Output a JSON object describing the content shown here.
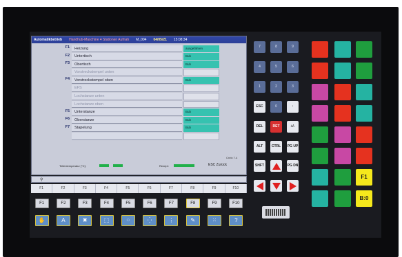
{
  "titlebar": {
    "mode": "Automatikbetrieb",
    "subtitle": "Handhub-Maschine 4 Stationen Aufnah",
    "program": "M_004",
    "date": "04/05/21",
    "time": "15:08:34"
  },
  "rows": [
    {
      "key": "F1",
      "label": "Heizung",
      "status": "ausgefahren",
      "state": "on",
      "disabled": false
    },
    {
      "key": "F2",
      "label": "Untertisch",
      "status": "Bub",
      "state": "on",
      "disabled": false
    },
    {
      "key": "F3",
      "label": "Obertisch",
      "status": "Bub",
      "state": "on",
      "disabled": false
    },
    {
      "key": "",
      "label": "Vorstreckstempel unten",
      "status": "",
      "state": "off",
      "disabled": true
    },
    {
      "key": "F4",
      "label": "Vorstreckstempel oben",
      "status": "Bub",
      "state": "on",
      "disabled": false
    },
    {
      "key": "",
      "label": "EFS",
      "status": "",
      "state": "off",
      "disabled": true
    },
    {
      "key": "",
      "label": "Lochstanze unten",
      "status": "",
      "state": "off",
      "disabled": true
    },
    {
      "key": "",
      "label": "Lochstanze oben",
      "status": "",
      "state": "off",
      "disabled": true
    },
    {
      "key": "F5",
      "label": "Unterstanze",
      "status": "Bub",
      "state": "on",
      "disabled": false
    },
    {
      "key": "F6",
      "label": "Oberstanze",
      "status": "Bub",
      "state": "on",
      "disabled": false
    },
    {
      "key": "F7",
      "label": "Stapelung",
      "status": "Bub",
      "state": "on",
      "disabled": false
    },
    {
      "key": "",
      "label": "",
      "status": "",
      "state": "off",
      "disabled": true
    }
  ],
  "status_line": {
    "temp_label": "Tellentemperatur [°C]:",
    "recipe_label": "Rezept:",
    "esc_label": "ESC Zurück",
    "cycle_label": "Crein 7.4"
  },
  "fstrip": [
    "F1",
    "F2",
    "F3",
    "F4",
    "F5",
    "F6",
    "F7",
    "F8",
    "F9",
    "F10"
  ],
  "fkeys": [
    "F1",
    "F2",
    "F3",
    "F4",
    "F5",
    "F6",
    "F7",
    "F8",
    "F9",
    "F10"
  ],
  "icon_keys": [
    {
      "icon": "hand-icon",
      "glyph": "✋"
    },
    {
      "icon": "letter-a-icon",
      "glyph": "A"
    },
    {
      "icon": "tools-icon",
      "glyph": "✖"
    },
    {
      "icon": "frame-icon",
      "glyph": "⬚"
    },
    {
      "icon": "frame-dots-icon",
      "glyph": "⁘"
    },
    {
      "icon": "frame-arrows-icon",
      "glyph": "⁛"
    },
    {
      "icon": "station-icon",
      "glyph": "⋮"
    },
    {
      "icon": "wrench-icon",
      "glyph": "✎"
    },
    {
      "icon": "grid-icon",
      "glyph": "⁙"
    },
    {
      "icon": "help-icon",
      "glyph": "?"
    }
  ],
  "keypad": {
    "numbers": [
      "7",
      "8",
      "9",
      "4",
      "5",
      "6",
      "1",
      "2",
      "3",
      "0"
    ],
    "esc": "ESC",
    "dot": "·",
    "del": "DEL",
    "ret": "RET",
    "plusminus": "+/-",
    "alt": "ALT",
    "ctrl": "CTRL",
    "pgup": "PG UP",
    "shft": "SHFT",
    "pgdn": "PG DN"
  },
  "softkeys": {
    "f1": "F1",
    "b0": "B:0"
  },
  "colors": {
    "accent_green": "#36c2b0",
    "title_blue": "#3147a8",
    "red_key": "#e5321f"
  }
}
